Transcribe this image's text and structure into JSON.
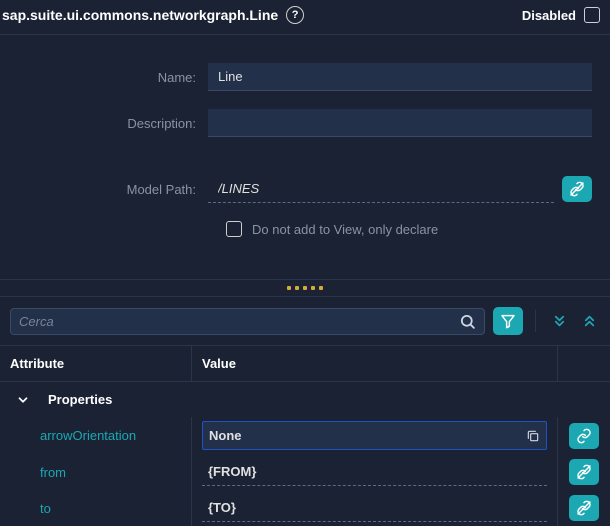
{
  "header": {
    "title": "sap.suite.ui.commons.networkgraph.Line",
    "disabled_label": "Disabled",
    "disabled_checked": false
  },
  "form": {
    "name_label": "Name:",
    "name_value": "Line",
    "description_label": "Description:",
    "description_value": "",
    "model_path_label": "Model Path:",
    "model_path_value": "/LINES",
    "declare_only_label": "Do not add to View, only declare",
    "declare_only_checked": false
  },
  "search": {
    "placeholder": "Cerca"
  },
  "table": {
    "header_attribute": "Attribute",
    "header_value": "Value",
    "groups": [
      {
        "name": "Properties",
        "expanded": true,
        "rows": [
          {
            "attr": "arrowOrientation",
            "value": "None",
            "kind": "select"
          },
          {
            "attr": "from",
            "value": "{FROM}",
            "kind": "text"
          },
          {
            "attr": "to",
            "value": "{TO}",
            "kind": "text"
          }
        ]
      }
    ]
  }
}
